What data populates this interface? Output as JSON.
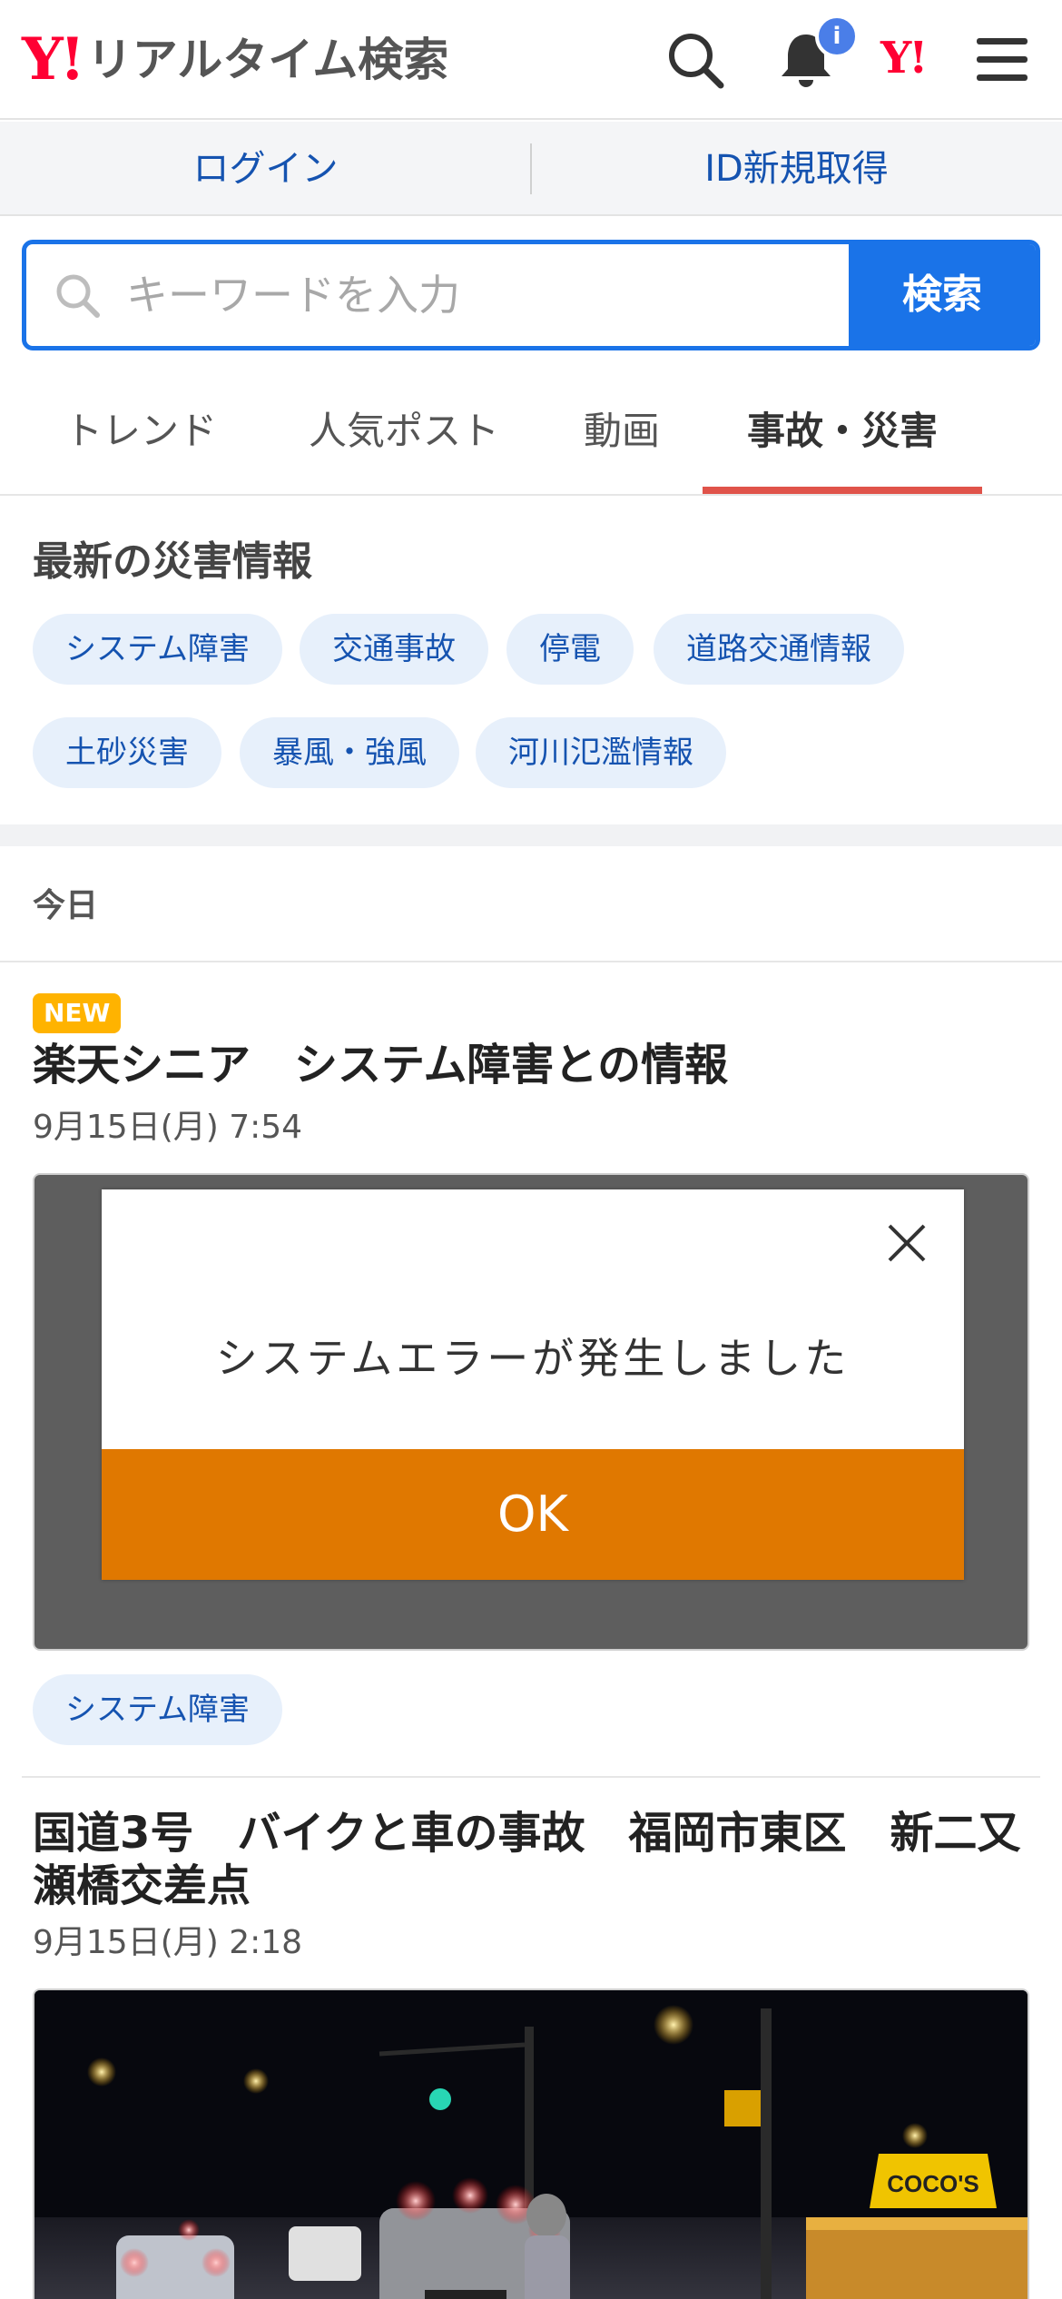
{
  "header": {
    "logo_mark": "Y!",
    "logo_text": "リアルタイム検索",
    "notification_badge": "i",
    "yahoo_mark": "Y!"
  },
  "auth": {
    "login_label": "ログイン",
    "signup_label": "ID新規取得"
  },
  "search": {
    "placeholder": "キーワードを入力",
    "button_label": "検索"
  },
  "tabs": [
    {
      "label": "トレンド",
      "active": false
    },
    {
      "label": "人気ポスト",
      "active": false
    },
    {
      "label": "動画",
      "active": false
    },
    {
      "label": "事故・災害",
      "active": true
    }
  ],
  "disaster": {
    "title": "最新の災害情報",
    "chips": [
      "システム障害",
      "交通事故",
      "停電",
      "道路交通情報",
      "土砂災害",
      "暴風・強風",
      "河川氾濫情報"
    ]
  },
  "feed": {
    "date_label": "今日",
    "posts": [
      {
        "badge": "NEW",
        "title": "楽天シニア　システム障害との情報",
        "time": "9月15日(月) 7:54",
        "image": {
          "dialog_message": "システムエラーが発生しました",
          "dialog_button": "OK"
        },
        "tag": "システム障害"
      },
      {
        "title_line1": "国道3号　バイクと車の事故　福岡市東区　新二又",
        "title_line2": "瀬橋交差点",
        "time": "9月15日(月) 2:18",
        "image": {
          "sign_text": "COCO'S"
        }
      }
    ]
  },
  "colors": {
    "brand_red": "#ff0033",
    "link_blue": "#1553b0",
    "search_blue": "#1a73e8",
    "tab_underline": "#e0534a",
    "chip_bg": "#e7f0fb",
    "new_badge": "#ffb300",
    "ok_orange": "#e07800"
  }
}
